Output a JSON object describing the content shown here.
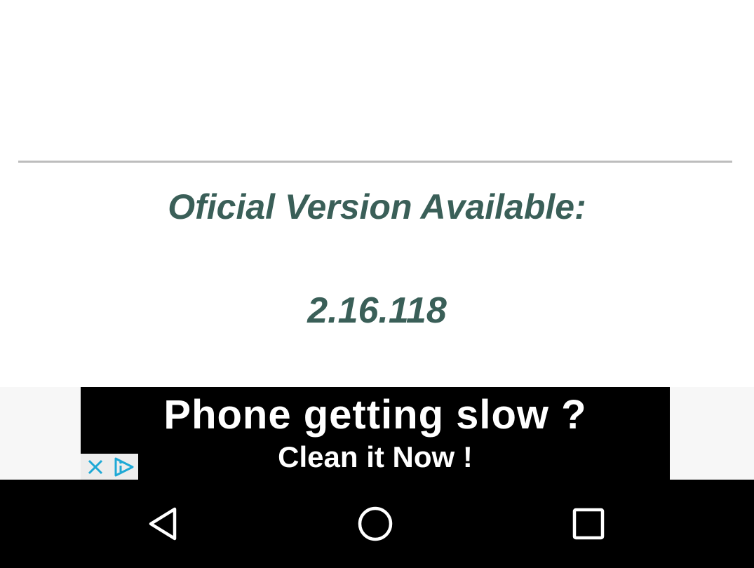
{
  "content": {
    "heading": "Oficial Version Available:",
    "version": "2.16.118"
  },
  "ad": {
    "headline": "Phone getting slow ?",
    "subline": "Clean it Now !"
  },
  "navbar": {
    "back": "back-icon",
    "home": "home-icon",
    "recents": "recents-icon"
  },
  "colors": {
    "text_accent": "#3a5f58",
    "divider": "#bdbdbd",
    "ad_choices": "#1fa9d6"
  }
}
